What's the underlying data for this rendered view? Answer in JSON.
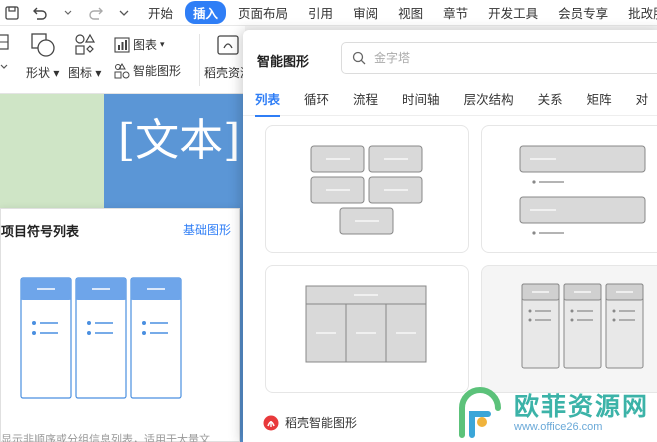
{
  "menubar": {
    "undo_icon": "undo-icon",
    "redo_icon": "redo-icon",
    "dropdown_icon": "chevron-down-icon",
    "items": [
      {
        "label": "开始",
        "active": false
      },
      {
        "label": "插入",
        "active": true
      },
      {
        "label": "页面布局",
        "active": false
      },
      {
        "label": "引用",
        "active": false
      },
      {
        "label": "审阅",
        "active": false
      },
      {
        "label": "视图",
        "active": false
      },
      {
        "label": "章节",
        "active": false
      },
      {
        "label": "开发工具",
        "active": false
      },
      {
        "label": "会员专享",
        "active": false
      },
      {
        "label": "批改服务",
        "active": false
      }
    ]
  },
  "ribbon": {
    "shape_label": "形状",
    "icon_label": "图标",
    "chart_label": "图表",
    "smartart_label": "智能图形",
    "daoke_label": "稻壳资源"
  },
  "document": {
    "text": "[文本]"
  },
  "preview": {
    "title": "项目符号列表",
    "link": "基础图形",
    "description": "显示非顺序或分组信息列表，适用于大量文"
  },
  "dialog": {
    "title": "智能图形",
    "search_placeholder": "金字塔",
    "tabs": [
      {
        "label": "列表",
        "active": true
      },
      {
        "label": "循环",
        "active": false
      },
      {
        "label": "流程",
        "active": false
      },
      {
        "label": "时间轴",
        "active": false
      },
      {
        "label": "层次结构",
        "active": false
      },
      {
        "label": "关系",
        "active": false
      },
      {
        "label": "矩阵",
        "active": false
      },
      {
        "label": "对",
        "active": false
      }
    ],
    "footer": "稻壳智能图形"
  },
  "watermark": {
    "main": "欧菲资源网",
    "url": "www.office26.com"
  },
  "colors": {
    "accent": "#2f7ef6",
    "doc_blue": "#5b96d6",
    "doc_green": "#cfe5c6",
    "watermark": "#3cb3a8"
  }
}
